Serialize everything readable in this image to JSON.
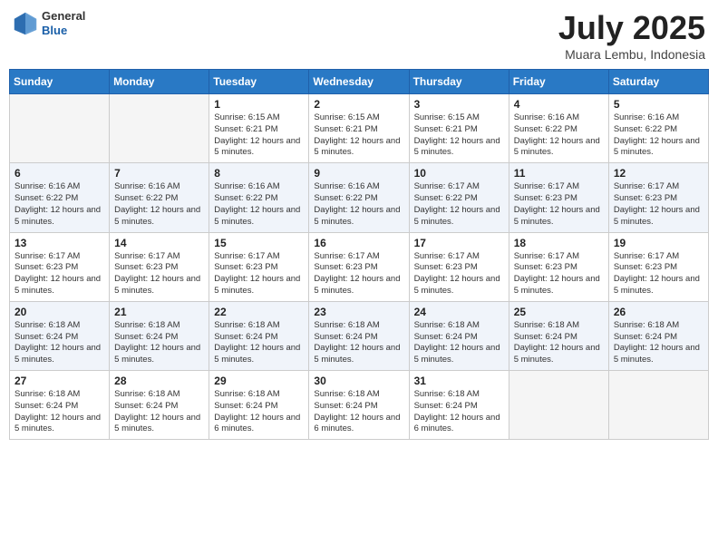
{
  "logo": {
    "general": "General",
    "blue": "Blue"
  },
  "title": {
    "month_year": "July 2025",
    "location": "Muara Lembu, Indonesia"
  },
  "weekdays": [
    "Sunday",
    "Monday",
    "Tuesday",
    "Wednesday",
    "Thursday",
    "Friday",
    "Saturday"
  ],
  "weeks": [
    [
      {
        "day": "",
        "sunrise": "",
        "sunset": "",
        "daylight": ""
      },
      {
        "day": "",
        "sunrise": "",
        "sunset": "",
        "daylight": ""
      },
      {
        "day": "1",
        "sunrise": "Sunrise: 6:15 AM",
        "sunset": "Sunset: 6:21 PM",
        "daylight": "Daylight: 12 hours and 5 minutes."
      },
      {
        "day": "2",
        "sunrise": "Sunrise: 6:15 AM",
        "sunset": "Sunset: 6:21 PM",
        "daylight": "Daylight: 12 hours and 5 minutes."
      },
      {
        "day": "3",
        "sunrise": "Sunrise: 6:15 AM",
        "sunset": "Sunset: 6:21 PM",
        "daylight": "Daylight: 12 hours and 5 minutes."
      },
      {
        "day": "4",
        "sunrise": "Sunrise: 6:16 AM",
        "sunset": "Sunset: 6:22 PM",
        "daylight": "Daylight: 12 hours and 5 minutes."
      },
      {
        "day": "5",
        "sunrise": "Sunrise: 6:16 AM",
        "sunset": "Sunset: 6:22 PM",
        "daylight": "Daylight: 12 hours and 5 minutes."
      }
    ],
    [
      {
        "day": "6",
        "sunrise": "Sunrise: 6:16 AM",
        "sunset": "Sunset: 6:22 PM",
        "daylight": "Daylight: 12 hours and 5 minutes."
      },
      {
        "day": "7",
        "sunrise": "Sunrise: 6:16 AM",
        "sunset": "Sunset: 6:22 PM",
        "daylight": "Daylight: 12 hours and 5 minutes."
      },
      {
        "day": "8",
        "sunrise": "Sunrise: 6:16 AM",
        "sunset": "Sunset: 6:22 PM",
        "daylight": "Daylight: 12 hours and 5 minutes."
      },
      {
        "day": "9",
        "sunrise": "Sunrise: 6:16 AM",
        "sunset": "Sunset: 6:22 PM",
        "daylight": "Daylight: 12 hours and 5 minutes."
      },
      {
        "day": "10",
        "sunrise": "Sunrise: 6:17 AM",
        "sunset": "Sunset: 6:22 PM",
        "daylight": "Daylight: 12 hours and 5 minutes."
      },
      {
        "day": "11",
        "sunrise": "Sunrise: 6:17 AM",
        "sunset": "Sunset: 6:23 PM",
        "daylight": "Daylight: 12 hours and 5 minutes."
      },
      {
        "day": "12",
        "sunrise": "Sunrise: 6:17 AM",
        "sunset": "Sunset: 6:23 PM",
        "daylight": "Daylight: 12 hours and 5 minutes."
      }
    ],
    [
      {
        "day": "13",
        "sunrise": "Sunrise: 6:17 AM",
        "sunset": "Sunset: 6:23 PM",
        "daylight": "Daylight: 12 hours and 5 minutes."
      },
      {
        "day": "14",
        "sunrise": "Sunrise: 6:17 AM",
        "sunset": "Sunset: 6:23 PM",
        "daylight": "Daylight: 12 hours and 5 minutes."
      },
      {
        "day": "15",
        "sunrise": "Sunrise: 6:17 AM",
        "sunset": "Sunset: 6:23 PM",
        "daylight": "Daylight: 12 hours and 5 minutes."
      },
      {
        "day": "16",
        "sunrise": "Sunrise: 6:17 AM",
        "sunset": "Sunset: 6:23 PM",
        "daylight": "Daylight: 12 hours and 5 minutes."
      },
      {
        "day": "17",
        "sunrise": "Sunrise: 6:17 AM",
        "sunset": "Sunset: 6:23 PM",
        "daylight": "Daylight: 12 hours and 5 minutes."
      },
      {
        "day": "18",
        "sunrise": "Sunrise: 6:17 AM",
        "sunset": "Sunset: 6:23 PM",
        "daylight": "Daylight: 12 hours and 5 minutes."
      },
      {
        "day": "19",
        "sunrise": "Sunrise: 6:17 AM",
        "sunset": "Sunset: 6:23 PM",
        "daylight": "Daylight: 12 hours and 5 minutes."
      }
    ],
    [
      {
        "day": "20",
        "sunrise": "Sunrise: 6:18 AM",
        "sunset": "Sunset: 6:24 PM",
        "daylight": "Daylight: 12 hours and 5 minutes."
      },
      {
        "day": "21",
        "sunrise": "Sunrise: 6:18 AM",
        "sunset": "Sunset: 6:24 PM",
        "daylight": "Daylight: 12 hours and 5 minutes."
      },
      {
        "day": "22",
        "sunrise": "Sunrise: 6:18 AM",
        "sunset": "Sunset: 6:24 PM",
        "daylight": "Daylight: 12 hours and 5 minutes."
      },
      {
        "day": "23",
        "sunrise": "Sunrise: 6:18 AM",
        "sunset": "Sunset: 6:24 PM",
        "daylight": "Daylight: 12 hours and 5 minutes."
      },
      {
        "day": "24",
        "sunrise": "Sunrise: 6:18 AM",
        "sunset": "Sunset: 6:24 PM",
        "daylight": "Daylight: 12 hours and 5 minutes."
      },
      {
        "day": "25",
        "sunrise": "Sunrise: 6:18 AM",
        "sunset": "Sunset: 6:24 PM",
        "daylight": "Daylight: 12 hours and 5 minutes."
      },
      {
        "day": "26",
        "sunrise": "Sunrise: 6:18 AM",
        "sunset": "Sunset: 6:24 PM",
        "daylight": "Daylight: 12 hours and 5 minutes."
      }
    ],
    [
      {
        "day": "27",
        "sunrise": "Sunrise: 6:18 AM",
        "sunset": "Sunset: 6:24 PM",
        "daylight": "Daylight: 12 hours and 5 minutes."
      },
      {
        "day": "28",
        "sunrise": "Sunrise: 6:18 AM",
        "sunset": "Sunset: 6:24 PM",
        "daylight": "Daylight: 12 hours and 5 minutes."
      },
      {
        "day": "29",
        "sunrise": "Sunrise: 6:18 AM",
        "sunset": "Sunset: 6:24 PM",
        "daylight": "Daylight: 12 hours and 6 minutes."
      },
      {
        "day": "30",
        "sunrise": "Sunrise: 6:18 AM",
        "sunset": "Sunset: 6:24 PM",
        "daylight": "Daylight: 12 hours and 6 minutes."
      },
      {
        "day": "31",
        "sunrise": "Sunrise: 6:18 AM",
        "sunset": "Sunset: 6:24 PM",
        "daylight": "Daylight: 12 hours and 6 minutes."
      },
      {
        "day": "",
        "sunrise": "",
        "sunset": "",
        "daylight": ""
      },
      {
        "day": "",
        "sunrise": "",
        "sunset": "",
        "daylight": ""
      }
    ]
  ]
}
